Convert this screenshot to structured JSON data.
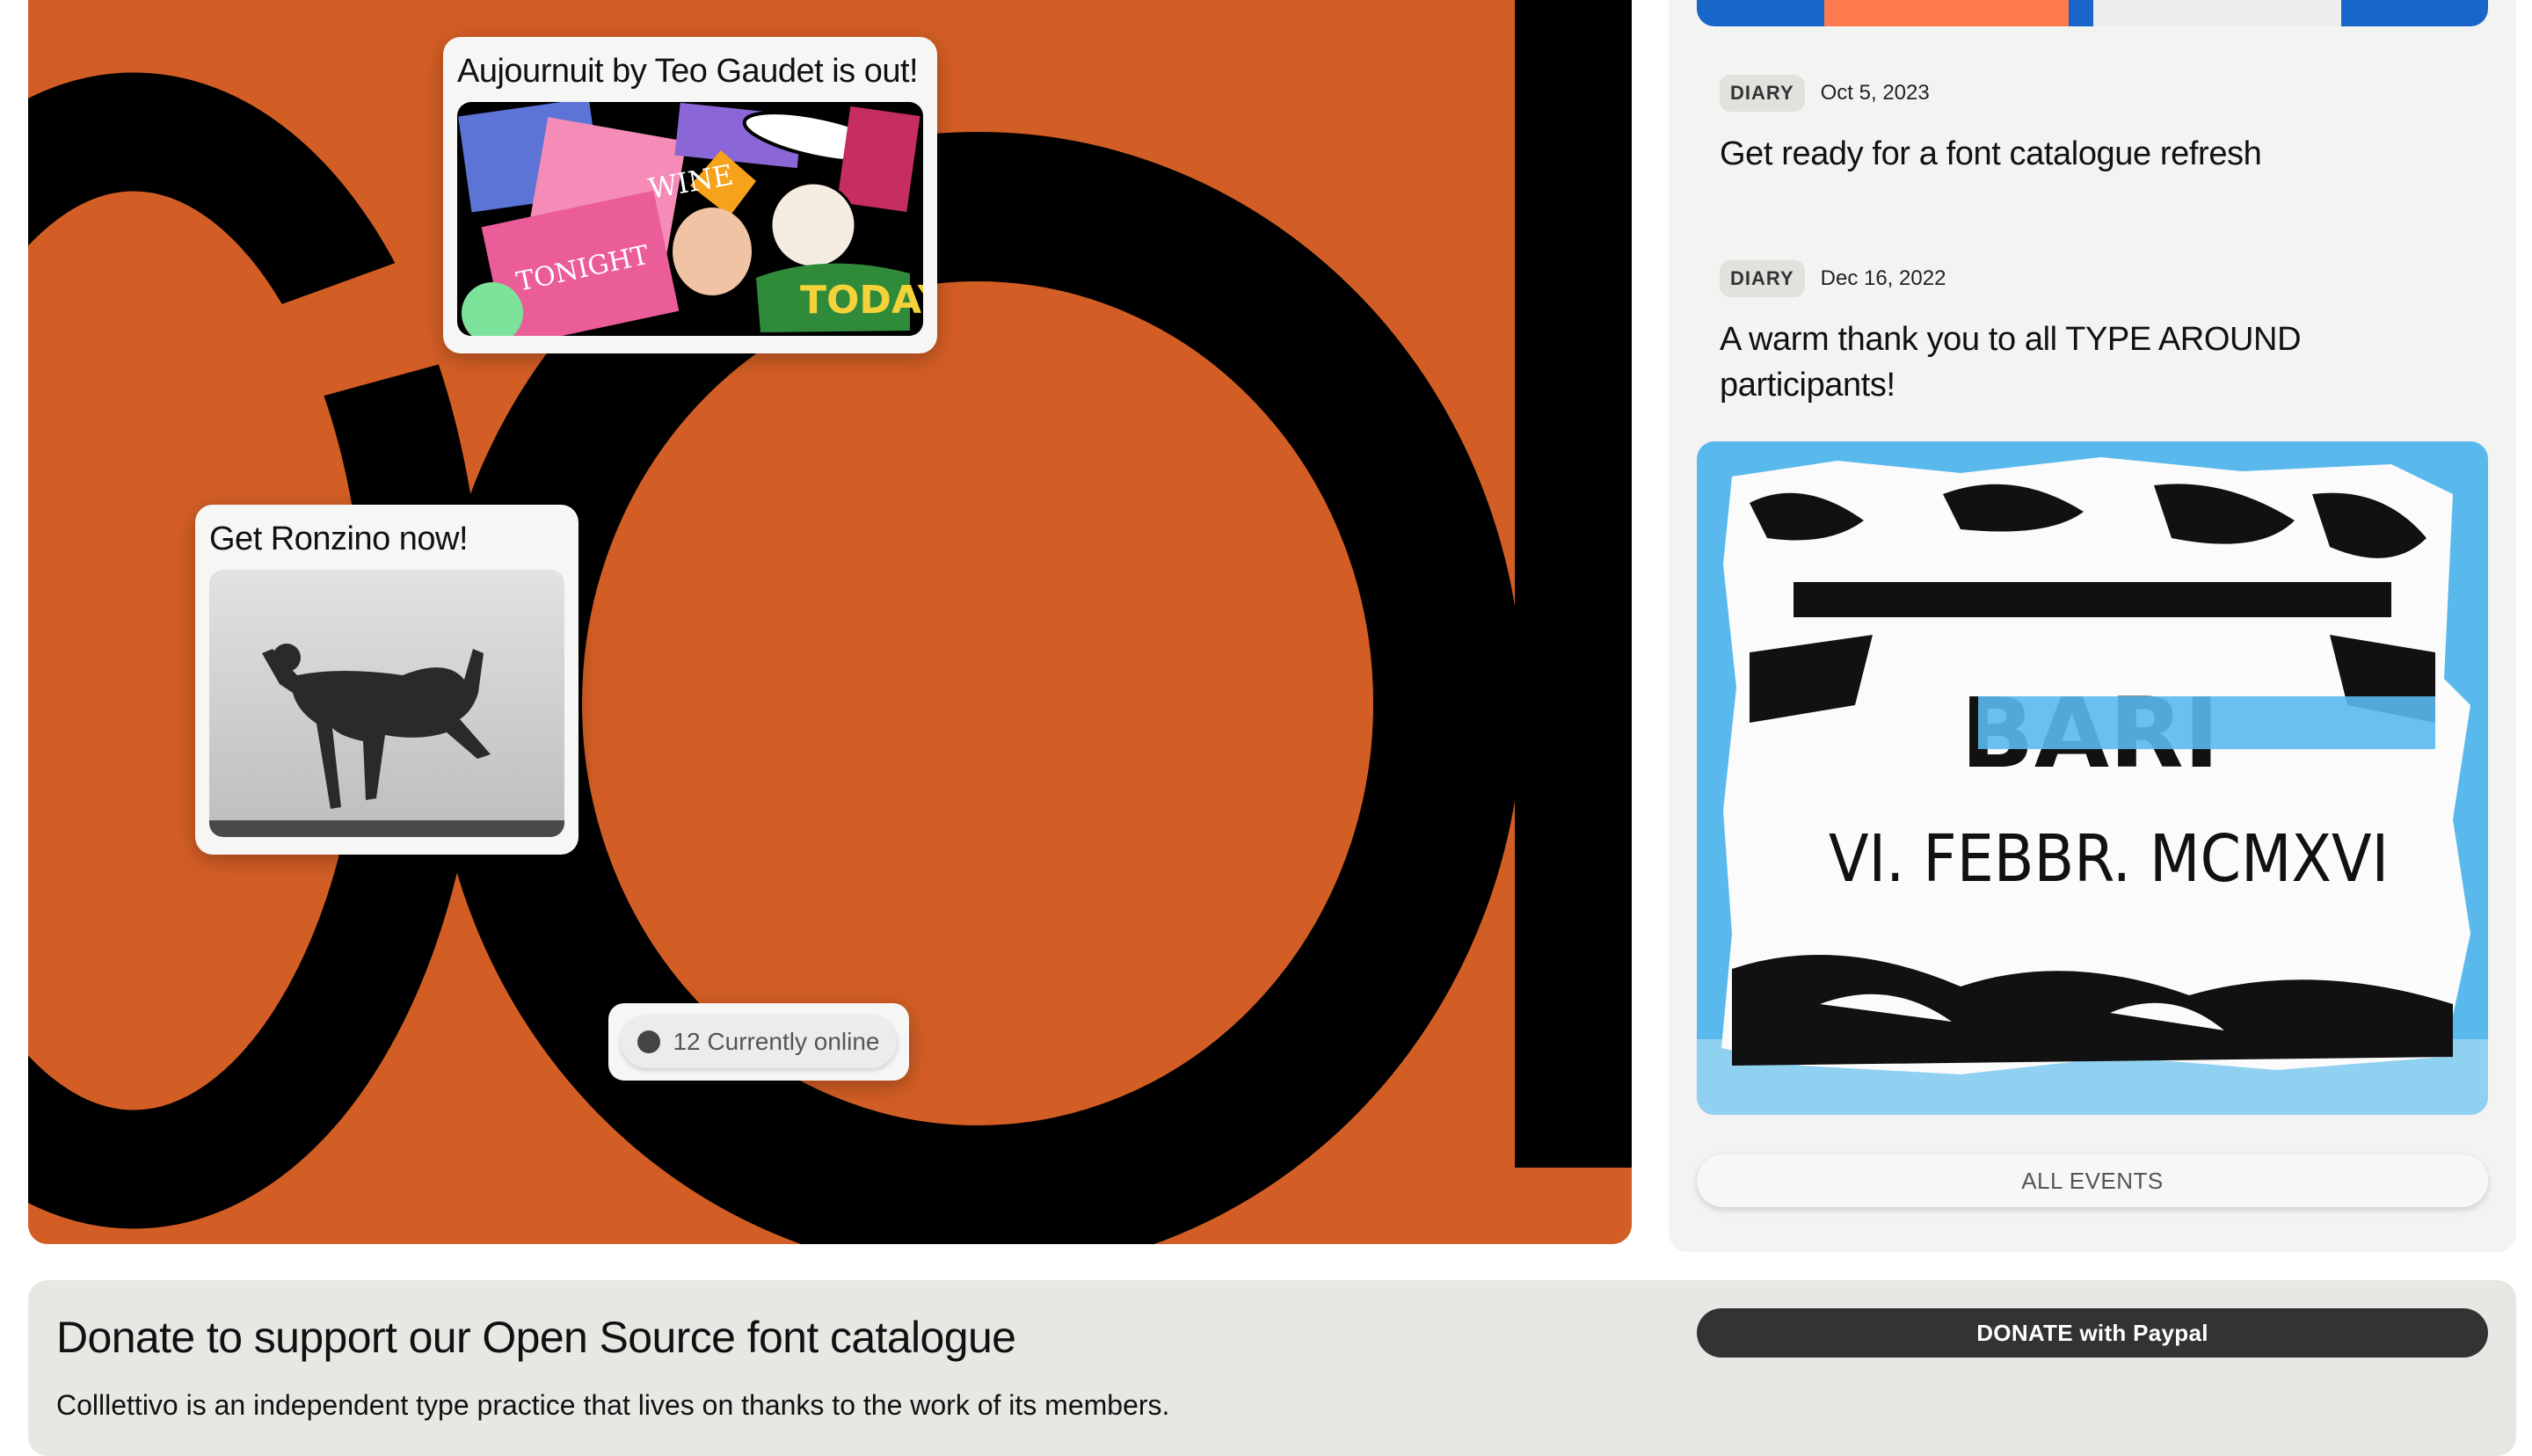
{
  "hero": {
    "card_release": {
      "title": "Aujournuit by Teo Gaudet is out!"
    },
    "card_ronzino": {
      "title": "Get Ronzino now!"
    },
    "online_status": {
      "text": "12 Currently online"
    }
  },
  "sidebar": {
    "news": [
      {
        "tag": "DIARY",
        "date": "Oct 5, 2023",
        "title": "Get ready for a font catalogue refresh"
      },
      {
        "tag": "DIARY",
        "date": "Dec 16, 2022",
        "title": "A warm thank you to all TYPE AROUND participants!"
      }
    ],
    "event_image": {
      "text_line_1": "BARI",
      "text_line_2": "VI. FEBBR. MCMXVI"
    },
    "all_events_label": "ALL EVENTS"
  },
  "donate": {
    "title": "Donate to support our Open Source font catalogue",
    "text": "Colllettivo is an independent type practice that lives on thanks to the work of its members.",
    "button_label": "DONATE with Paypal"
  },
  "colors": {
    "hero_orange": "#d35e25",
    "sidebar_bg": "#f3f3f1",
    "donate_bg": "#e7e7e4",
    "event_blue": "#5ab9ec",
    "button_dark": "#333333"
  },
  "icons": {
    "online_indicator": "status-dot-icon"
  }
}
